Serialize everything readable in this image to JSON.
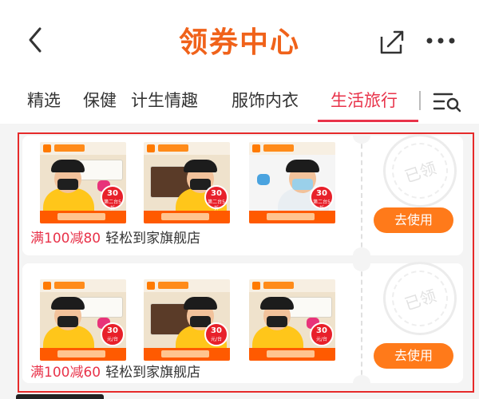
{
  "header": {
    "title": "领券中心",
    "back_icon": "back-chevron-icon",
    "share_icon": "share-icon",
    "more_icon": "more-dots-icon"
  },
  "tabs": [
    {
      "label": "精选",
      "active": false
    },
    {
      "label": "保健",
      "active": false
    },
    {
      "label": "计生情趣",
      "active": false
    },
    {
      "label": "服饰内衣",
      "active": false
    },
    {
      "label": "生活旅行",
      "active": true
    }
  ],
  "filter_icon": "filter-menu-icon",
  "coupons": [
    {
      "amount": "满100减80",
      "store": "轻松到家旗舰店",
      "button_label": "去使用",
      "stamp_text": "已领",
      "thumbnails": [
        {
          "badge": "30",
          "badge_sub": "第二台5折"
        },
        {
          "badge": "30",
          "badge_sub": "第二台5折"
        },
        {
          "badge": "30",
          "badge_sub": "第二台5折"
        }
      ]
    },
    {
      "amount": "满100减60",
      "store": "轻松到家旗舰店",
      "button_label": "去使用",
      "stamp_text": "已领",
      "thumbnails": [
        {
          "badge": "30",
          "badge_sub": "元/台"
        },
        {
          "badge": "30",
          "badge_sub": "元/台"
        },
        {
          "badge": "30",
          "badge_sub": "元/台"
        }
      ]
    }
  ],
  "colors": {
    "title_orange": "#f0621a",
    "active_tab_red": "#e8334a",
    "button_orange": "#ff7a1a",
    "highlight_red": "#e62a2a"
  }
}
